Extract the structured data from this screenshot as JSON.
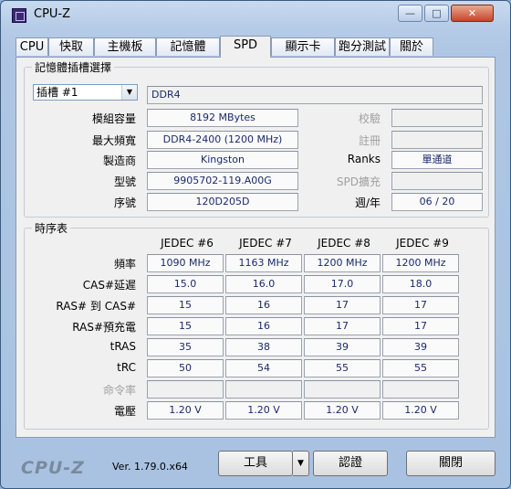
{
  "window": {
    "title": "CPU-Z"
  },
  "tabs": [
    {
      "label": "CPU"
    },
    {
      "label": "快取"
    },
    {
      "label": "主機板"
    },
    {
      "label": "記憶體"
    },
    {
      "label": "SPD"
    },
    {
      "label": "顯示卡"
    },
    {
      "label": "跑分測試"
    },
    {
      "label": "關於"
    }
  ],
  "slot_group": {
    "title": "記憶體插槽選擇",
    "slot_select": "插槽 #1",
    "memory_type": "DDR4",
    "labels": {
      "module_size": "模組容量",
      "max_bandwidth": "最大頻寬",
      "manufacturer": "製造商",
      "part_number": "型號",
      "serial_number": "序號",
      "correction": "校驗",
      "registered": "註冊",
      "ranks": "Ranks",
      "spd_ext": "SPD擴充",
      "week_year": "週/年"
    },
    "values": {
      "module_size": "8192 MBytes",
      "max_bandwidth": "DDR4-2400 (1200 MHz)",
      "manufacturer": "Kingston",
      "part_number": "9905702-119.A00G",
      "serial_number": "120D205D",
      "ranks": "單通道",
      "week_year": "06 / 20"
    }
  },
  "timings": {
    "title": "時序表",
    "columns": [
      "JEDEC #6",
      "JEDEC #7",
      "JEDEC #8",
      "JEDEC #9"
    ],
    "rows": [
      {
        "label": "頻率",
        "values": [
          "1090 MHz",
          "1163 MHz",
          "1200 MHz",
          "1200 MHz"
        ]
      },
      {
        "label": "CAS#延遲",
        "values": [
          "15.0",
          "16.0",
          "17.0",
          "18.0"
        ]
      },
      {
        "label": "RAS# 到 CAS#",
        "values": [
          "15",
          "16",
          "17",
          "17"
        ]
      },
      {
        "label": "RAS#預充電",
        "values": [
          "15",
          "16",
          "17",
          "17"
        ]
      },
      {
        "label": "tRAS",
        "values": [
          "35",
          "38",
          "39",
          "39"
        ]
      },
      {
        "label": "tRC",
        "values": [
          "50",
          "54",
          "55",
          "55"
        ]
      },
      {
        "label": "命令率",
        "values": [
          "",
          "",
          "",
          ""
        ]
      },
      {
        "label": "電壓",
        "values": [
          "1.20 V",
          "1.20 V",
          "1.20 V",
          "1.20 V"
        ]
      }
    ]
  },
  "footer": {
    "logo": "CPU-Z",
    "version": "Ver. 1.79.0.x64",
    "tools_label": "工具",
    "validate_label": "認證",
    "close_label": "關閉"
  }
}
